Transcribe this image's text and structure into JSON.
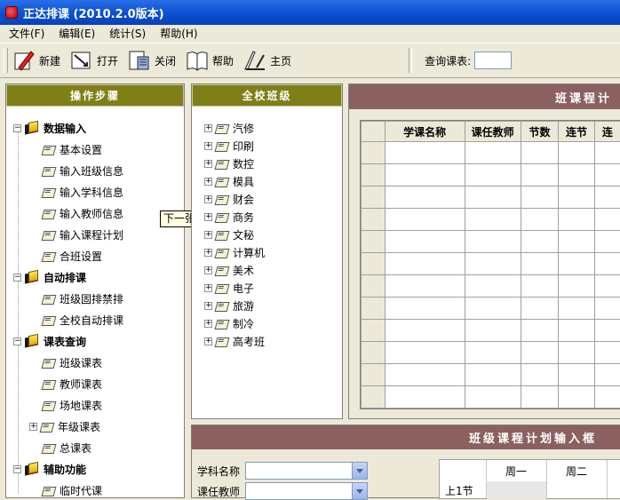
{
  "window": {
    "title": "正达排课 (2010.2.0版本)"
  },
  "menu": [
    "文件(F)",
    "编辑(E)",
    "统计(S)",
    "帮助(H)"
  ],
  "toolbar": {
    "buttons": [
      "新建",
      "打开",
      "关闭",
      "帮助",
      "主页"
    ],
    "query_label": "查询课表:"
  },
  "steps": {
    "header": "操作步骤",
    "groups": [
      {
        "label": "数据输入",
        "items": [
          "基本设置",
          "输入班级信息",
          "输入学科信息",
          "输入教师信息",
          "输入课程计划",
          "合班设置"
        ]
      },
      {
        "label": "自动排课",
        "items": [
          "班级固排禁排",
          "全校自动排课"
        ]
      },
      {
        "label": "课表查询",
        "items": [
          "班级课表",
          "教师课表",
          "场地课表",
          "年级课表",
          "总课表"
        ]
      },
      {
        "label": "辅助功能",
        "items": [
          "临时代课"
        ]
      }
    ]
  },
  "tooltip": "下一张",
  "classes": {
    "header": "全校班级",
    "items": [
      "汽修",
      "印刷",
      "数控",
      "模具",
      "财会",
      "商务",
      "文秘",
      "计算机",
      "美术",
      "电子",
      "旅游",
      "制冷",
      "高考班"
    ]
  },
  "plan": {
    "header": "班课程计",
    "columns": [
      "学课名称",
      "课任教师",
      "节数",
      "连节",
      "连"
    ]
  },
  "input": {
    "header": "班级课程计划输入框",
    "subject_label": "学科名称",
    "teacher_label": "课任教师",
    "days": [
      "周一",
      "周二"
    ],
    "period_label": "上1节"
  }
}
